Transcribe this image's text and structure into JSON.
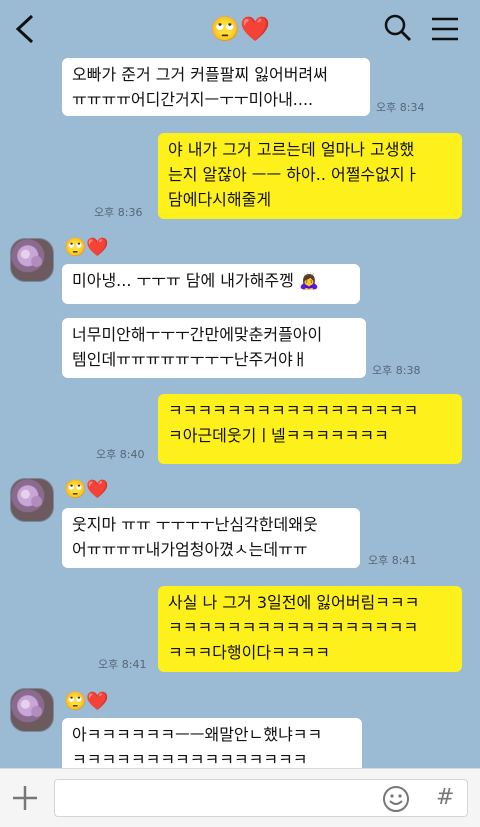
{
  "header": {
    "title": "🙄❤️",
    "back_icon": "chevron-left-icon",
    "search_icon": "search-icon",
    "menu_icon": "hamburger-menu-icon"
  },
  "messages": [
    {
      "sender": "in",
      "text": "오빠가 준거 그거 커플팔찌 잃어버려써\nㅠㅠㅠㅠ어디간거지ㅡㅜㅜ미아내....",
      "time": "오후 8:34"
    },
    {
      "sender": "out",
      "text": "야 내가 그거 고르는데 얼마나 고생했\n는지 알잖아 ㅡㅡ 하아.. 어쩔수없지ㅏ\n담에다시해줄게",
      "time": "오후 8:36"
    },
    {
      "sender": "in",
      "name": "🙄❤️",
      "text": "미아냉... ㅜㅜㅠ 담에 내가해주껭 🙇‍♀️",
      "time": ""
    },
    {
      "sender": "in",
      "text": "너무미안해ㅜㅜㅜ간만에맞춘커플아이\n템인데ㅠㅠㅠㅠㅠㅜㅜㅜ난주거야ㅐ",
      "time": "오후 8:38"
    },
    {
      "sender": "out",
      "text": "ㅋㅋㅋㅋㅋㅋㅋㅋㅋㅋㅋㅋㅋㅋㅋㅋㅋ\nㅋ아근데웃기ㅣ넬ㅋㅋㅋㅋㅋㅋㅋ",
      "time": "오후 8:40"
    },
    {
      "sender": "in",
      "name": "🙄❤️",
      "text": "웃지마 ㅠㅠ ㅜㅜㅜㅜ난심각한데왜웃\n어ㅠㅠㅠㅠ내가엄청아꼈ㅅ는데ㅠㅠ",
      "time": "오후 8:41"
    },
    {
      "sender": "out",
      "text": "사실 나 그거 3일전에 잃어버림ㅋㅋㅋ\nㅋㅋㅋㅋㅋㅋㅋㅋㅋㅋㅋㅋㅋㅋㅋㅋㅋ\nㅋㅋㅋ다행이다ㅋㅋㅋㅋ",
      "time": "오후 8:41"
    },
    {
      "sender": "in",
      "name": "🙄❤️",
      "text": "아ㅋㅋㅋㅋㅋㅋㅡㅡ왜말안ㄴ했냐ㅋㅋ\nㅋㅋㅋㅋㅋㅋㅋㅋㅋㅋㅋㅋㅋㅋㅋㅋ",
      "time": ""
    }
  ],
  "bottom": {
    "plus_icon": "plus-icon",
    "emoji_icon": "emoji-icon",
    "hash_label": "#",
    "input_placeholder": ""
  }
}
